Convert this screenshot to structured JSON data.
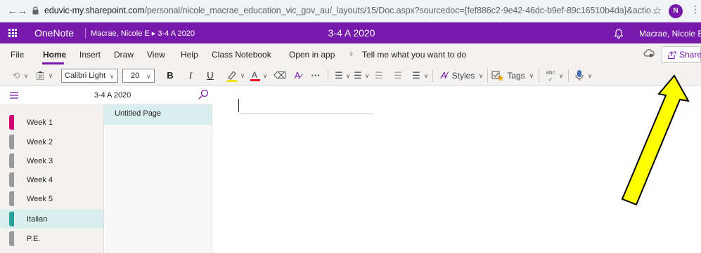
{
  "browser": {
    "url_host": "eduvic-my.sharepoint.com",
    "url_rest": "/personal/nicole_macrae_education_vic_gov_au/_layouts/15/Doc.aspx?sourcedoc={fef886c2-9e42-46dc-b9ef-89c16510b4da}&actio...",
    "profile_initial": "N",
    "icons": [
      "back-arrow-icon",
      "forward-arrow-icon",
      "reload-icon",
      "lock-icon",
      "star-icon",
      "kebab-icon"
    ]
  },
  "header": {
    "app_name": "OneNote",
    "breadcrumb": "Macrae, Nicole E ▸ 3-4 A 2020",
    "notebook_title": "3-4 A 2020",
    "user_name": "Macrae, Nicole E",
    "brand_color": "#7719aa"
  },
  "ribbon": {
    "tabs": [
      "File",
      "Home",
      "Insert",
      "Draw",
      "View",
      "Help",
      "Class Notebook",
      "Open in app"
    ],
    "active_tab": "Home",
    "tell_me": "Tell me what you want to do",
    "share_label": "Share"
  },
  "toolbar": {
    "font_name": "Calibri Light",
    "font_size": "20",
    "bold": "B",
    "italic": "I",
    "underline": "U",
    "more": "···",
    "styles_label": "Styles",
    "tags_label": "Tags",
    "spell_label": "abc"
  },
  "navigation": {
    "notebook_title": "3-4 A 2020",
    "sections": [
      {
        "label": "Week 1",
        "color": "#d0006f"
      },
      {
        "label": "Week 2",
        "color": "#9a9a9a"
      },
      {
        "label": "Week 3",
        "color": "#9a9a9a"
      },
      {
        "label": "Week 4",
        "color": "#9a9a9a"
      },
      {
        "label": "Week 5",
        "color": "#9a9a9a"
      },
      {
        "label": "Italian",
        "color": "#2aa198"
      },
      {
        "label": "P.E.",
        "color": "#9a9a9a"
      }
    ],
    "selected_section": "Italian",
    "pages": [
      "Untitled Page"
    ]
  }
}
